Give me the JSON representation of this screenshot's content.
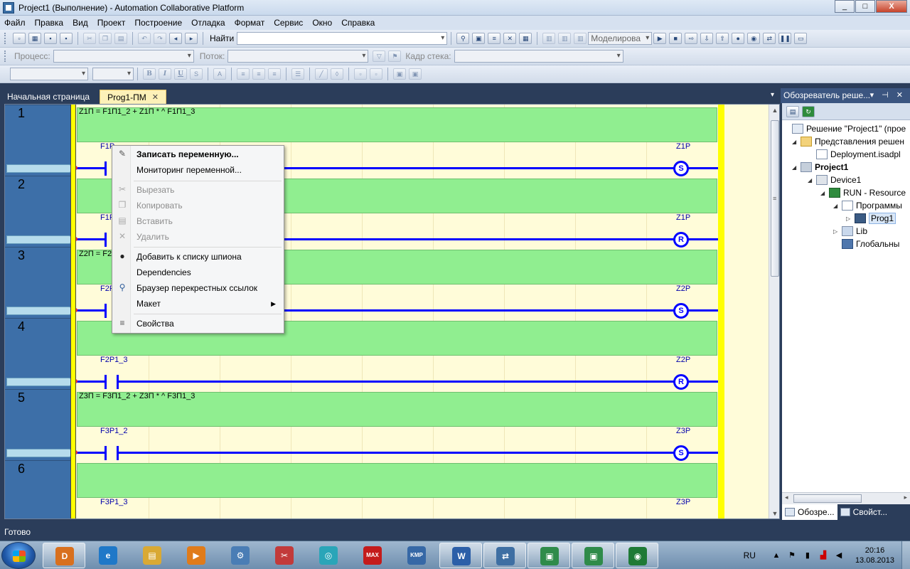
{
  "window": {
    "title": "Project1 (Выполнение) - Automation Collaborative Platform",
    "min": "_",
    "max": "□",
    "close": "X"
  },
  "menu": [
    "Файл",
    "Правка",
    "Вид",
    "Проект",
    "Построение",
    "Отладка",
    "Формат",
    "Сервис",
    "Окно",
    "Справка"
  ],
  "toolbar1": {
    "find_label": "Найти",
    "find_value": "",
    "sim_label": "Моделирова"
  },
  "toolbar2": {
    "process_label": "Процесс:",
    "thread_label": "Поток:",
    "frame_label": "Кадр стека:"
  },
  "tabs": {
    "start": "Начальная страница",
    "active": "Prog1-ПМ",
    "close": "✕",
    "menu": "▾"
  },
  "networks": [
    {
      "num": "1",
      "comment": "Z1П = F1П1_2 + Z1П * ^ F1П1_3",
      "contact": "F1P",
      "coil": "Z1P",
      "coil_type": "S"
    },
    {
      "num": "2",
      "comment": "",
      "contact": "F1P",
      "coil": "Z1P",
      "coil_type": "R"
    },
    {
      "num": "3",
      "comment": "Z2П = F2П",
      "contact": "F2P",
      "coil": "Z2P",
      "coil_type": "S"
    },
    {
      "num": "4",
      "comment": "",
      "contact": "F2P1_3",
      "coil": "Z2P",
      "coil_type": "R"
    },
    {
      "num": "5",
      "comment": "Z3П = F3П1_2 + Z3П * ^ F3П1_3",
      "contact": "F3P1_2",
      "coil": "Z3P",
      "coil_type": "S"
    },
    {
      "num": "6",
      "comment": "",
      "contact": "F3P1_3",
      "coil": "Z3P",
      "coil_type": ""
    }
  ],
  "context_menu": [
    {
      "label": "Записать переменную...",
      "icon": "pencil-icon",
      "glyph": "✎",
      "disabled": false,
      "bold": true
    },
    {
      "label": "Мониторинг переменной...",
      "icon": "",
      "glyph": "",
      "disabled": false,
      "bold": false
    },
    {
      "label": "Вырезать",
      "icon": "scissors-icon",
      "glyph": "✂",
      "disabled": true,
      "bold": false
    },
    {
      "label": "Копировать",
      "icon": "copy-icon",
      "glyph": "❐",
      "disabled": true,
      "bold": false
    },
    {
      "label": "Вставить",
      "icon": "paste-icon",
      "glyph": "▤",
      "disabled": true,
      "bold": false
    },
    {
      "label": "Удалить",
      "icon": "delete-icon",
      "glyph": "✕",
      "disabled": true,
      "bold": false
    },
    {
      "label": "Добавить к списку шпиона",
      "icon": "spy-icon",
      "glyph": "●",
      "disabled": false,
      "bold": false
    },
    {
      "label": "Dependencies",
      "icon": "",
      "glyph": "",
      "disabled": false,
      "bold": false
    },
    {
      "label": "Браузер перекрестных ссылок",
      "icon": "magnifier-icon",
      "glyph": "⚲",
      "disabled": false,
      "bold": false
    },
    {
      "label": "Макет",
      "icon": "",
      "glyph": "",
      "disabled": false,
      "bold": false,
      "submenu": "▶"
    },
    {
      "label": "Свойства",
      "icon": "properties-icon",
      "glyph": "≡",
      "disabled": false,
      "bold": false
    }
  ],
  "solution_explorer": {
    "title": "Обозреватель реше...",
    "buttons": "▾ ⊣ ✕",
    "tree": [
      {
        "label": "Решение \"Project1\"  (прое",
        "icon": "solution-icon",
        "exp": "",
        "bold": false,
        "sel": false
      },
      {
        "label": "Представления решен",
        "icon": "folder-icon",
        "exp": "◢",
        "bold": false,
        "sel": false
      },
      {
        "label": "Deployment.isadpl",
        "icon": "file-icon",
        "exp": "",
        "bold": false,
        "sel": false
      },
      {
        "label": "Project1",
        "icon": "project-icon",
        "exp": "◢",
        "bold": true,
        "sel": false
      },
      {
        "label": "Device1",
        "icon": "device-icon",
        "exp": "◢",
        "bold": false,
        "sel": false
      },
      {
        "label": "RUN - Resource",
        "icon": "resource-icon",
        "exp": "◢",
        "bold": false,
        "sel": false
      },
      {
        "label": "Программы",
        "icon": "programs-icon",
        "exp": "◢",
        "bold": false,
        "sel": false
      },
      {
        "label": "Prog1",
        "icon": "program-icon",
        "exp": "▷",
        "bold": false,
        "sel": true
      },
      {
        "label": "Lib",
        "icon": "library-icon",
        "exp": "▷",
        "bold": false,
        "sel": false
      },
      {
        "label": "Глобальны",
        "icon": "globals-icon",
        "exp": "",
        "bold": false,
        "sel": false
      }
    ],
    "bottom_tabs": [
      "Обозре...",
      "Свойст..."
    ]
  },
  "status": "Готово",
  "taskbar": {
    "lang": "RU",
    "time": "20:16",
    "date": "13.08.2013",
    "apps": [
      {
        "name": "acp-app-icon",
        "glyph": "D",
        "color": "#d8701e",
        "open": true
      },
      {
        "name": "ie-icon",
        "glyph": "e",
        "color": "#1f78c8",
        "open": false
      },
      {
        "name": "explorer-icon",
        "glyph": "▤",
        "color": "#d9a934",
        "open": false
      },
      {
        "name": "media-player-icon",
        "glyph": "▶",
        "color": "#e07b1a",
        "open": false
      },
      {
        "name": "tool-icon",
        "glyph": "⚙",
        "color": "#4a7db5",
        "open": false
      },
      {
        "name": "scissors-app-icon",
        "glyph": "✂",
        "color": "#c23a3a",
        "open": false
      },
      {
        "name": "lens-icon",
        "glyph": "◎",
        "color": "#2aa5b8",
        "open": false
      },
      {
        "name": "maxpack-icon",
        "glyph": "MAX",
        "color": "#c41b1b",
        "open": false
      },
      {
        "name": "kmplayer-icon",
        "glyph": "KMP",
        "color": "#3668a6",
        "open": false
      },
      {
        "name": "word-icon",
        "glyph": "W",
        "color": "#2c5fa8",
        "open": true
      },
      {
        "name": "network-app-icon",
        "glyph": "⇄",
        "color": "#3e6fa3",
        "open": true
      },
      {
        "name": "window-app-icon",
        "glyph": "▣",
        "color": "#2f8b4a",
        "open": true
      },
      {
        "name": "window-app-icon-2",
        "glyph": "▣",
        "color": "#2f8b4a",
        "open": true
      },
      {
        "name": "monitor-app-icon",
        "glyph": "◉",
        "color": "#1f7a36",
        "open": true
      }
    ]
  }
}
